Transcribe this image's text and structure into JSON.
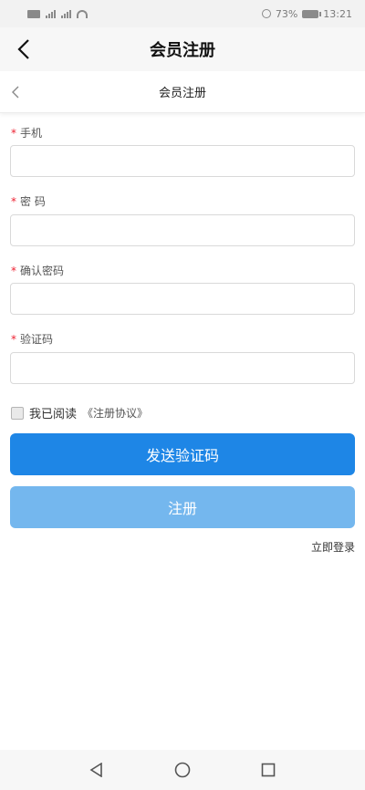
{
  "status_bar": {
    "battery": "73%",
    "time": "13:21"
  },
  "app_header": {
    "title": "会员注册"
  },
  "page_header": {
    "title": "会员注册"
  },
  "form": {
    "required_mark": "*",
    "fields": [
      {
        "label": "手机",
        "value": ""
      },
      {
        "label": "密 码",
        "value": ""
      },
      {
        "label": "确认密码",
        "value": ""
      },
      {
        "label": "验证码",
        "value": ""
      }
    ],
    "agree_text": "我已阅读",
    "agreement_link": "《注册协议》",
    "agree_checked": false
  },
  "buttons": {
    "send_code": "发送验证码",
    "register": "注册"
  },
  "login_link": "立即登录",
  "colors": {
    "primary": "#1e86e6",
    "primary_disabled": "#74b7ee"
  }
}
